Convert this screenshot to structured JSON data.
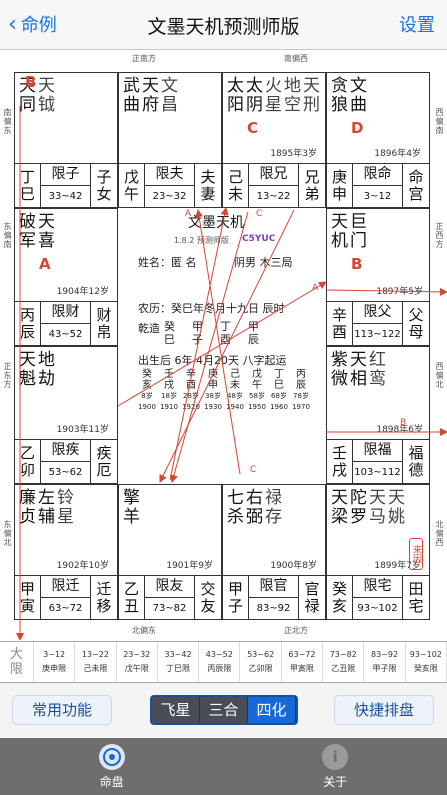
{
  "nav": {
    "back": "命例",
    "title": "文墨天机预测师版",
    "settings": "设置"
  },
  "directions": {
    "top_left": "正南方",
    "top_right": "南偏西",
    "right_top": "西偏南",
    "right_mid": "正西方",
    "right_low": "西偏北",
    "right_bottom": "北偏西",
    "bottom_left": "北偏东",
    "bottom_right": "正北方",
    "left_top": "南偏东",
    "left_mid": "东偏南",
    "left_low": "正东方",
    "left_bottom": "东偏北"
  },
  "palaces": [
    {
      "id": "si",
      "stars": [
        [
          "天",
          "同"
        ],
        [
          "天",
          "钺"
        ]
      ],
      "hua": "B",
      "age": "",
      "gz": [
        "丁",
        "巳"
      ],
      "name": "限子",
      "range": "33~42",
      "pn": [
        "子",
        "女"
      ]
    },
    {
      "id": "wu",
      "stars": [
        [
          "武",
          "曲"
        ],
        [
          "天",
          "府"
        ],
        [
          "文",
          "昌"
        ]
      ],
      "hua": "",
      "age": "",
      "gz": [
        "戊",
        "午"
      ],
      "name": "限夫",
      "range": "23~32",
      "pn": [
        "夫",
        "妻"
      ]
    },
    {
      "id": "wei",
      "stars": [
        [
          "太",
          "阳"
        ],
        [
          "太",
          "阴"
        ],
        [
          "火",
          "星"
        ],
        [
          "地",
          "空"
        ],
        [
          "天",
          "刑"
        ]
      ],
      "hua": "C",
      "age": "1895年3岁",
      "gz": [
        "己",
        "未"
      ],
      "name": "限兄",
      "range": "13~22",
      "pn": [
        "兄",
        "弟"
      ]
    },
    {
      "id": "shen",
      "stars": [
        [
          "贪",
          "狼"
        ],
        [
          "文",
          "曲"
        ]
      ],
      "hua": "D",
      "age": "1896年4岁",
      "gz": [
        "庚",
        "申"
      ],
      "name": "限命",
      "range": "3~12",
      "pn": [
        "命",
        "宫"
      ]
    },
    {
      "id": "chen",
      "stars": [
        [
          "破",
          "军"
        ],
        [
          "天",
          "喜"
        ]
      ],
      "hua": "A",
      "age": "1904年12岁",
      "gz": [
        "丙",
        "辰"
      ],
      "name": "限财",
      "range": "43~52",
      "pn": [
        "财",
        "帛"
      ]
    },
    {
      "id": "you",
      "stars": [
        [
          "天",
          "机"
        ],
        [
          "巨",
          "门"
        ]
      ],
      "hua": "B",
      "age": "1897年5岁",
      "gz": [
        "辛",
        "酉"
      ],
      "name": "限父",
      "range": "113~122",
      "pn": [
        "父",
        "母"
      ]
    },
    {
      "id": "mao",
      "stars": [
        [
          "天",
          "魁"
        ],
        [
          "地",
          "劫"
        ]
      ],
      "hua": "",
      "age": "1903年11岁",
      "gz": [
        "乙",
        "卯"
      ],
      "name": "限疾",
      "range": "53~62",
      "pn": [
        "疾",
        "厄"
      ]
    },
    {
      "id": "xu",
      "stars": [
        [
          "紫",
          "微"
        ],
        [
          "天",
          "相"
        ],
        [
          "红",
          "鸾"
        ]
      ],
      "hua": "",
      "age": "1898年6岁",
      "gz": [
        "壬",
        "戌"
      ],
      "name": "限福",
      "range": "103~112",
      "pn": [
        "福",
        "德"
      ]
    },
    {
      "id": "yin",
      "stars": [
        [
          "廉",
          "贞"
        ],
        [
          "左",
          "辅"
        ],
        [
          "铃",
          "星"
        ]
      ],
      "hua": "",
      "age": "1902年10岁",
      "gz": [
        "甲",
        "寅"
      ],
      "name": "限迁",
      "range": "63~72",
      "pn": [
        "迁",
        "移"
      ]
    },
    {
      "id": "chou",
      "stars": [
        [
          "擎",
          "羊"
        ]
      ],
      "hua": "",
      "age": "1901年9岁",
      "gz": [
        "乙",
        "丑"
      ],
      "name": "限友",
      "range": "73~82",
      "pn": [
        "交",
        "友"
      ]
    },
    {
      "id": "zi",
      "stars": [
        [
          "七",
          "杀"
        ],
        [
          "右",
          "弼"
        ],
        [
          "禄",
          "存"
        ]
      ],
      "hua": "",
      "age": "1900年8岁",
      "gz": [
        "甲",
        "子"
      ],
      "name": "限官",
      "range": "83~92",
      "pn": [
        "官",
        "禄"
      ]
    },
    {
      "id": "hai",
      "stars": [
        [
          "天",
          "梁"
        ],
        [
          "陀",
          "罗"
        ],
        [
          "天",
          "马"
        ],
        [
          "天",
          "姚"
        ]
      ],
      "hua": "",
      "age": "1899年7岁",
      "gz": [
        "癸",
        "亥"
      ],
      "name": "限宅",
      "range": "93~102",
      "pn": [
        "田",
        "宅"
      ]
    }
  ],
  "center": {
    "title": "文墨天机",
    "version": "1.8.2 预测师版",
    "code": "C5YUC",
    "name_line": "姓名：匿 名",
    "ju": "阴男 木三局",
    "lunar": "农历：癸巳年冬月十九日 辰时",
    "qianzao_label": "乾造",
    "pillars": [
      [
        "癸",
        "巳"
      ],
      [
        "甲",
        "子"
      ],
      [
        "丁",
        "酉"
      ],
      [
        "甲",
        "辰"
      ]
    ],
    "birth_line": "出生后 6年 4月20天 八字起运",
    "dayun_gan": [
      "癸",
      "壬",
      "辛",
      "庚",
      "己",
      "戊",
      "丁",
      "丙"
    ],
    "dayun_zhi": [
      "亥",
      "戌",
      "酉",
      "申",
      "未",
      "午",
      "巳",
      "辰"
    ],
    "dayun_age": [
      "8岁",
      "18岁",
      "28岁",
      "38岁",
      "48岁",
      "58岁",
      "68岁",
      "78岁"
    ],
    "dayun_year": [
      "1900",
      "1910",
      "1920",
      "1930",
      "1940",
      "1950",
      "1960",
      "1970"
    ],
    "arrow_labels": [
      "A",
      "B",
      "C",
      "D"
    ],
    "seal": "来因"
  },
  "daxian": {
    "label": [
      "大",
      "限"
    ],
    "cells": [
      {
        "r": "3~12",
        "gz": "庚申限"
      },
      {
        "r": "13~22",
        "gz": "己未限"
      },
      {
        "r": "23~32",
        "gz": "戊午限"
      },
      {
        "r": "33~42",
        "gz": "丁巳限"
      },
      {
        "r": "43~52",
        "gz": "丙辰限"
      },
      {
        "r": "53~62",
        "gz": "乙卯限"
      },
      {
        "r": "63~72",
        "gz": "甲寅限"
      },
      {
        "r": "73~82",
        "gz": "乙丑限"
      },
      {
        "r": "83~92",
        "gz": "甲子限"
      },
      {
        "r": "93~102",
        "gz": "癸亥限"
      }
    ]
  },
  "toolbar": {
    "common": "常用功能",
    "seg": [
      "飞星",
      "三合",
      "四化"
    ],
    "seg_selected": 2,
    "quick": "快捷排盘"
  },
  "tabs": [
    {
      "label": "命盘",
      "icon": "target-icon"
    },
    {
      "label": "关于",
      "icon": "info-icon"
    }
  ],
  "colors": {
    "hua": "#d94433",
    "link": "#1a73e8",
    "seg_sel": "#1768d8"
  }
}
